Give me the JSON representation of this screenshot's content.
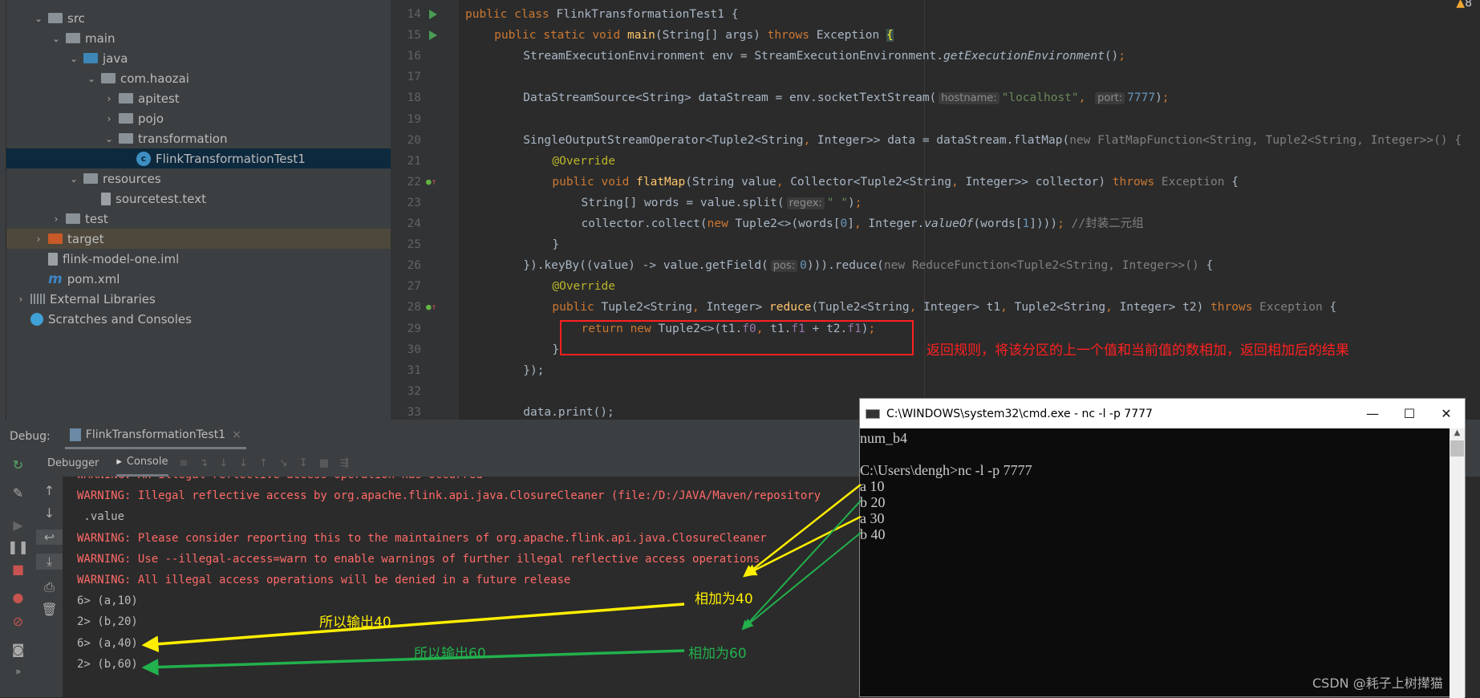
{
  "project": {
    "items": [
      {
        "label": "src",
        "level": 2,
        "icon": "folder",
        "exp": "v"
      },
      {
        "label": "main",
        "level": 3,
        "icon": "folder",
        "exp": "v"
      },
      {
        "label": "java",
        "level": 4,
        "icon": "folder-blue",
        "exp": "v"
      },
      {
        "label": "com.haozai",
        "level": 5,
        "icon": "package",
        "exp": "v"
      },
      {
        "label": "apitest",
        "level": 6,
        "icon": "package",
        "exp": ">"
      },
      {
        "label": "pojo",
        "level": 6,
        "icon": "package",
        "exp": ">"
      },
      {
        "label": "transformation",
        "level": 6,
        "icon": "package",
        "exp": "v"
      },
      {
        "label": "FlinkTransformationTest1",
        "level": 7,
        "icon": "class",
        "exp": "",
        "selected": true
      },
      {
        "label": "resources",
        "level": 4,
        "icon": "folder",
        "exp": "v"
      },
      {
        "label": "sourcetest.text",
        "level": 5,
        "icon": "file",
        "exp": ""
      },
      {
        "label": "test",
        "level": 3,
        "icon": "folder",
        "exp": ">"
      },
      {
        "label": "target",
        "level": 2,
        "icon": "folder-orange",
        "exp": ">",
        "highlight": true
      },
      {
        "label": "flink-model-one.iml",
        "level": 2,
        "icon": "file",
        "exp": ""
      },
      {
        "label": "pom.xml",
        "level": 2,
        "icon": "maven",
        "exp": ""
      },
      {
        "label": "External Libraries",
        "level": 1,
        "icon": "libraries",
        "exp": ">"
      },
      {
        "label": "Scratches and Consoles",
        "level": 1,
        "icon": "scratches",
        "exp": ""
      }
    ]
  },
  "editor": {
    "warning_count": "8",
    "lines": [
      {
        "n": "14",
        "gutter": "run",
        "indent": 0,
        "seg": [
          [
            "kw",
            "public class "
          ],
          [
            "",
            "FlinkTransformationTest1 {"
          ]
        ]
      },
      {
        "n": "15",
        "gutter": "run",
        "indent": 4,
        "seg": [
          [
            "kw",
            "public static void "
          ],
          [
            "fn",
            "main"
          ],
          [
            "",
            "(String[] args) "
          ],
          [
            "kw",
            "throws "
          ],
          [
            "",
            "Exception "
          ],
          [
            "brace",
            "{"
          ]
        ]
      },
      {
        "n": "16",
        "indent": 8,
        "seg": [
          [
            "",
            "StreamExecutionEnvironment env = StreamExecutionEnvironment."
          ],
          [
            "it",
            "getExecutionEnvironment"
          ],
          [
            "",
            "()"
          ],
          [
            "kw",
            ";"
          ]
        ]
      },
      {
        "n": "17",
        "indent": 0,
        "seg": []
      },
      {
        "n": "18",
        "indent": 8,
        "seg": [
          [
            "",
            "DataStreamSource<String> dataStream = env.socketTextStream("
          ],
          [
            "hint",
            "hostname:"
          ],
          [
            "str",
            "\"localhost\""
          ],
          [
            "kw",
            ", "
          ],
          [
            "hint",
            "port:"
          ],
          [
            "num",
            "7777"
          ],
          [
            "",
            ")"
          ],
          [
            "kw",
            ";"
          ]
        ]
      },
      {
        "n": "19",
        "indent": 0,
        "seg": []
      },
      {
        "n": "20",
        "indent": 8,
        "seg": [
          [
            "",
            "SingleOutputStreamOperator<Tuple2<String"
          ],
          [
            "kw",
            ", "
          ],
          [
            "",
            "Integer>> data = dataStream.flatMap("
          ],
          [
            "gr",
            "new FlatMapFunction<String, Tuple2<String, Integer>>() {"
          ]
        ]
      },
      {
        "n": "21",
        "indent": 12,
        "seg": [
          [
            "ann",
            "@Override"
          ]
        ]
      },
      {
        "n": "22",
        "gutter": "override",
        "indent": 12,
        "seg": [
          [
            "kw",
            "public void "
          ],
          [
            "fn",
            "flatMap"
          ],
          [
            "",
            "(String value"
          ],
          [
            "kw",
            ", "
          ],
          [
            "",
            "Collector<Tuple2<String"
          ],
          [
            "kw",
            ", "
          ],
          [
            "",
            "Integer>> collector) "
          ],
          [
            "kw",
            "throws "
          ],
          [
            "gr",
            "Exception "
          ],
          [
            "",
            "{"
          ]
        ]
      },
      {
        "n": "23",
        "indent": 16,
        "seg": [
          [
            "",
            "String[] words = value.split("
          ],
          [
            "hint",
            "regex:"
          ],
          [
            "str",
            "\" \""
          ],
          [
            "",
            ")"
          ],
          [
            "kw",
            ";"
          ]
        ]
      },
      {
        "n": "24",
        "indent": 16,
        "seg": [
          [
            "",
            "collector.collect("
          ],
          [
            "kw",
            "new "
          ],
          [
            "",
            "Tuple2<>(words["
          ],
          [
            "num",
            "0"
          ],
          [
            "",
            "]"
          ],
          [
            "kw",
            ", "
          ],
          [
            "",
            "Integer."
          ],
          [
            "it",
            "valueOf"
          ],
          [
            "",
            "(words["
          ],
          [
            "num",
            "1"
          ],
          [
            "",
            "])))"
          ],
          [
            "kw",
            "; "
          ],
          [
            "cm",
            "//封装二元组"
          ]
        ]
      },
      {
        "n": "25",
        "indent": 12,
        "seg": [
          [
            "",
            "}"
          ]
        ]
      },
      {
        "n": "26",
        "indent": 8,
        "seg": [
          [
            "",
            "}).keyBy((value) -> value.getField("
          ],
          [
            "hint",
            "pos:"
          ],
          [
            "num",
            "0"
          ],
          [
            "",
            "))).reduce("
          ],
          [
            "gr",
            "new ReduceFunction<Tuple2<String, Integer>>() "
          ],
          [
            "",
            "{"
          ]
        ]
      },
      {
        "n": "27",
        "indent": 12,
        "seg": [
          [
            "ann",
            "@Override"
          ]
        ]
      },
      {
        "n": "28",
        "gutter": "override",
        "indent": 12,
        "seg": [
          [
            "kw",
            "public "
          ],
          [
            "",
            "Tuple2<String"
          ],
          [
            "kw",
            ", "
          ],
          [
            "",
            "Integer> "
          ],
          [
            "fn",
            "reduce"
          ],
          [
            "",
            "(Tuple2<String"
          ],
          [
            "kw",
            ", "
          ],
          [
            "",
            "Integer> t1"
          ],
          [
            "kw",
            ", "
          ],
          [
            "",
            "Tuple2<String"
          ],
          [
            "kw",
            ", "
          ],
          [
            "",
            "Integer> t2) "
          ],
          [
            "kw",
            "throws "
          ],
          [
            "gr",
            "Exception "
          ],
          [
            "",
            "{"
          ]
        ]
      },
      {
        "n": "29",
        "indent": 16,
        "seg": [
          [
            "kw",
            "return new "
          ],
          [
            "",
            "Tuple2<>(t1."
          ],
          [
            "fd",
            "f0"
          ],
          [
            "kw",
            ", "
          ],
          [
            "",
            "t1."
          ],
          [
            "fd",
            "f1"
          ],
          [
            "",
            " + t2."
          ],
          [
            "fd",
            "f1"
          ],
          [
            "",
            ")"
          ],
          [
            "kw",
            ";"
          ]
        ]
      },
      {
        "n": "30",
        "indent": 12,
        "seg": [
          [
            "",
            "}"
          ]
        ]
      },
      {
        "n": "31",
        "indent": 8,
        "seg": [
          [
            "",
            "});"
          ]
        ]
      },
      {
        "n": "32",
        "indent": 0,
        "seg": []
      },
      {
        "n": "33",
        "indent": 8,
        "seg": [
          [
            "",
            "data.print();"
          ]
        ]
      }
    ]
  },
  "annotation_box_note": "返回规则，将该分区的上一个值和当前值的数相加，返回相加后的结果",
  "debug": {
    "label": "Debug:",
    "tab": "FlinkTransformationTest1",
    "debugger_tab": "Debugger",
    "console_tab": "Console"
  },
  "console": {
    "lines": [
      {
        "t": "WARNING: An illegal reflective access operation has occurred",
        "w": true
      },
      {
        "t": "WARNING: Illegal reflective access by org.apache.flink.api.java.ClosureCleaner (file:/D:/JAVA/Maven/repository",
        "w": true
      },
      {
        "t": " .value",
        "w": false
      },
      {
        "t": "WARNING: Please consider reporting this to the maintainers of org.apache.flink.api.java.ClosureCleaner",
        "w": true
      },
      {
        "t": "WARNING: Use --illegal-access=warn to enable warnings of further illegal reflective access operations",
        "w": true
      },
      {
        "t": "WARNING: All illegal access operations will be denied in a future release",
        "w": true
      },
      {
        "t": "6> (a,10)",
        "w": false
      },
      {
        "t": "2> (b,20)",
        "w": false
      },
      {
        "t": "6> (a,40)",
        "w": false
      },
      {
        "t": "2> (b,60)",
        "w": false
      }
    ]
  },
  "cmd": {
    "title": "C:\\WINDOWS\\system32\\cmd.exe - nc  -l -p 7777",
    "lines": [
      "num_b4",
      "",
      "C:\\Users\\dengh>nc -l -p 7777",
      "a 10",
      "b 20",
      "a 30",
      "b 40"
    ]
  },
  "notes": {
    "sum40": "相加为40",
    "out40": "所以输出40",
    "sum60": "相加为60",
    "out60": "所以输出60"
  },
  "colors": {
    "yellow": "#ffee00",
    "green": "#22b14c",
    "red": "#ff2020"
  },
  "watermark": "CSDN @耗子上树撵猫"
}
